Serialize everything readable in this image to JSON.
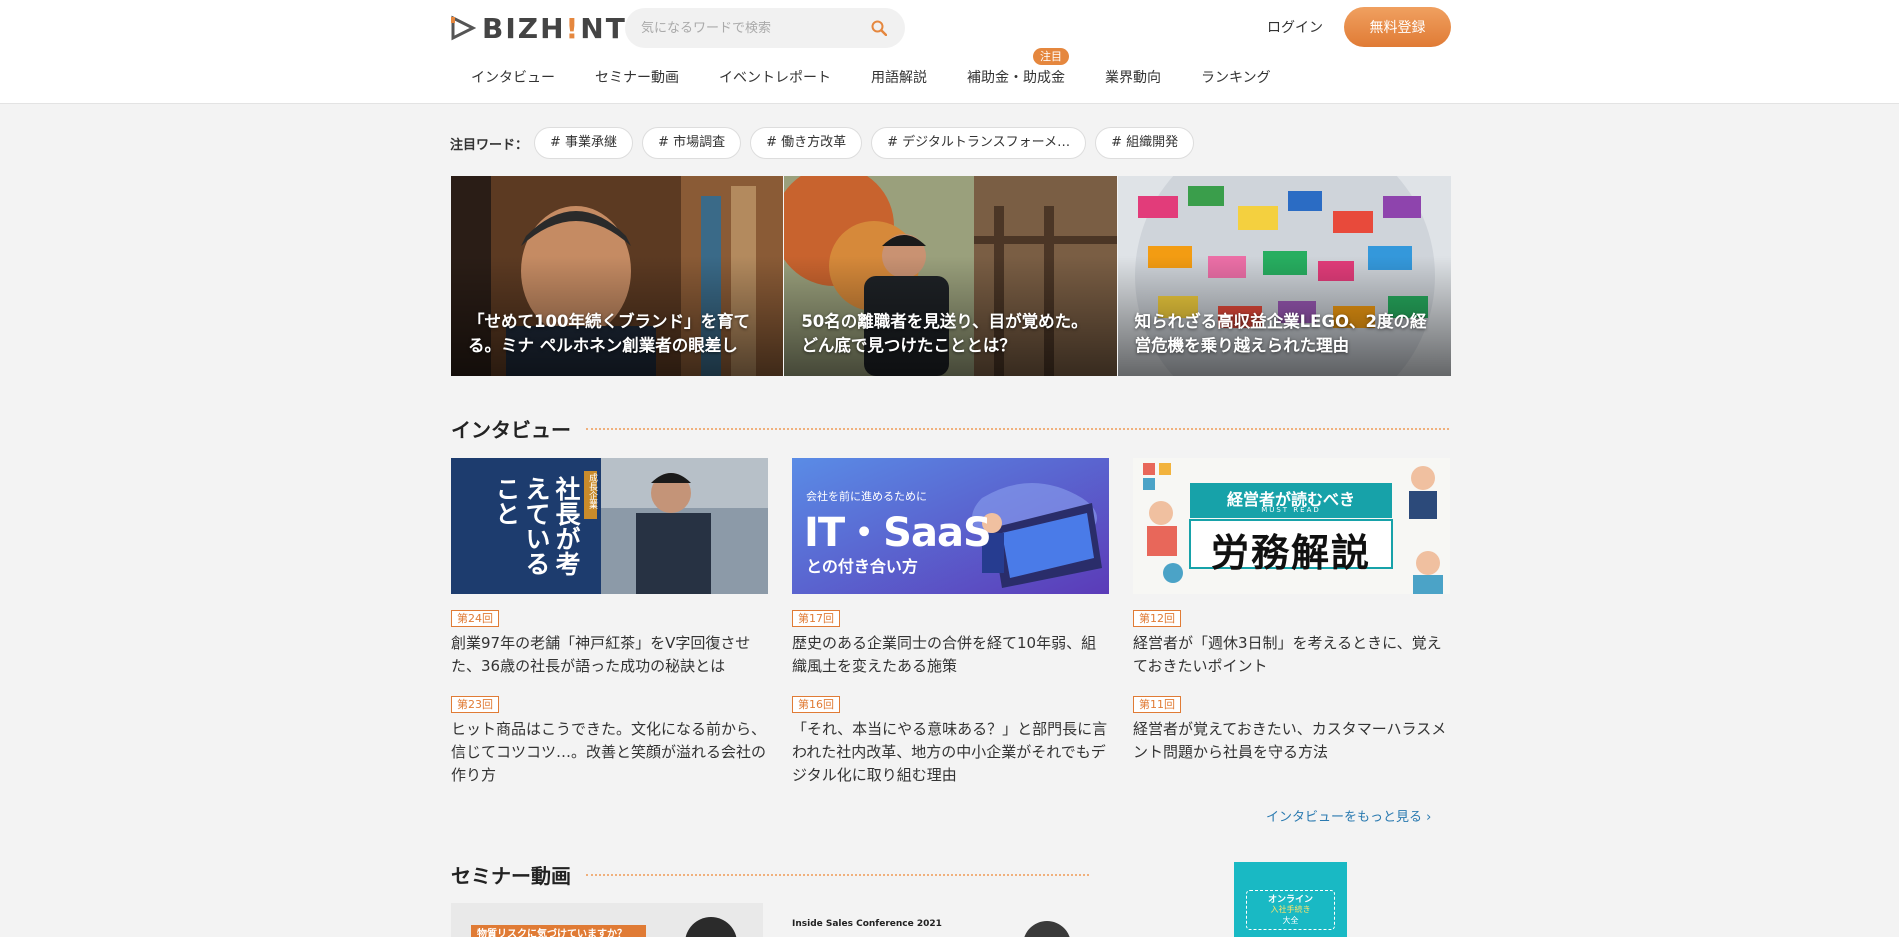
{
  "header": {
    "logo_text_a": "BIZH",
    "logo_text_b": "!",
    "logo_text_c": "NT",
    "search_placeholder": "気になるワードで検索",
    "login_label": "ログイン",
    "signup_label": "無料登録",
    "nav": [
      {
        "label": "インタビュー"
      },
      {
        "label": "セミナー動画"
      },
      {
        "label": "イベントレポート"
      },
      {
        "label": "用語解説"
      },
      {
        "label": "補助金・助成金",
        "badge": "注目"
      },
      {
        "label": "業界動向"
      },
      {
        "label": "ランキング"
      }
    ]
  },
  "hotwords": {
    "label": "注目ワード：",
    "tags": [
      "# 事業承継",
      "# 市場調査",
      "# 働き方改革",
      "# デジタルトランスフォーメ…",
      "# 組織開発"
    ]
  },
  "features": [
    {
      "caption": "「せめて100年続くブランド」を育てる。ミナ ペルホネン創業者の眼差し"
    },
    {
      "caption": "50名の離職者を見送り、目が覚めた。どん底で見つけたこととは？"
    },
    {
      "caption": "知られざる高収益企業LEGO、2度の経営危機を乗り越えられた理由"
    }
  ],
  "interview": {
    "heading": "インタビュー",
    "banners": [
      {
        "text_main": "社長が考えていること",
        "text_sub": "成長企業"
      },
      {
        "text_top": "会社を前に進めるために",
        "text_main": "IT・SaaS",
        "text_bottom": "との付き合い方"
      },
      {
        "text_top": "経営者が読むべき",
        "text_sub": "MUST READ",
        "text_main": "労務解説"
      }
    ],
    "articles": [
      {
        "badge": "第24回",
        "title": "創業97年の老舗「神戸紅茶」をV字回復させた、36歳の社長が語った成功の秘訣とは"
      },
      {
        "badge": "第17回",
        "title": "歴史のある企業同士の合併を経て10年弱、組織風土を変えたある施策"
      },
      {
        "badge": "第12回",
        "title": "経営者が「週休3日制」を考えるときに、覚えておきたいポイント"
      },
      {
        "badge": "第23回",
        "title": "ヒット商品はこうできた。文化になる前から、信じてコツコツ…。改善と笑顔が溢れる会社の作り方"
      },
      {
        "badge": "第16回",
        "title": "「それ、本当にやる意味ある？」と部門長に言われた社内改革、地方の中小企業がそれでもデジタル化に取り組む理由"
      },
      {
        "badge": "第11回",
        "title": "経営者が覚えておきたい、カスタマーハラスメント問題から社員を守る方法"
      }
    ],
    "more_label": "インタビューをもっと見る ›"
  },
  "seminar": {
    "heading": "セミナー動画",
    "thumb1_text": "物質リスクに気づけていますか？",
    "thumb2_text": "Inside Sales Conference 2021"
  },
  "ad": {
    "line1": "オンライン",
    "line2": "入社手続き",
    "line3": "大全"
  },
  "colors": {
    "accent": "#e5873e",
    "link": "#2a7ab0"
  }
}
